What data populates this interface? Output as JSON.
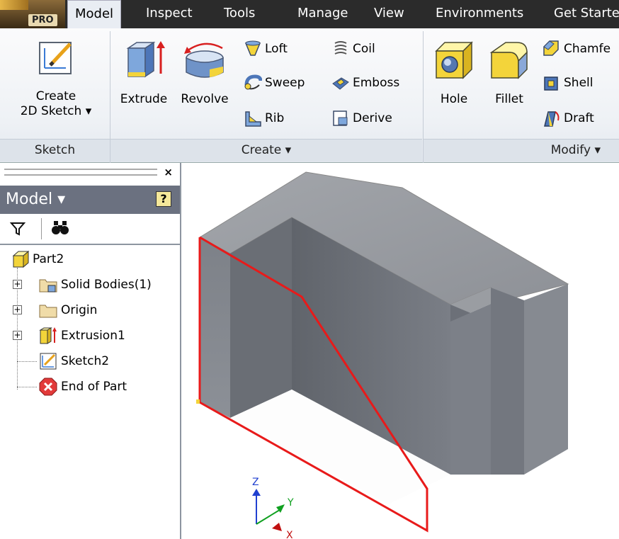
{
  "app": {
    "badge": "PRO"
  },
  "tabs": [
    {
      "label": "Model",
      "active": true
    },
    {
      "label": "Inspect"
    },
    {
      "label": "Tools"
    },
    {
      "label": "Manage"
    },
    {
      "label": "View"
    },
    {
      "label": "Environments"
    },
    {
      "label": "Get Starte"
    }
  ],
  "ribbon": {
    "sketch_panel": {
      "create_line1": "Create",
      "create_line2": "2D Sketch",
      "dropdown": "▾",
      "label": "Sketch"
    },
    "create_panel": {
      "extrude": "Extrude",
      "revolve": "Revolve",
      "loft": "Loft",
      "sweep": "Sweep",
      "rib": "Rib",
      "coil": "Coil",
      "emboss": "Emboss",
      "derive": "Derive",
      "label": "Create",
      "label_arrow": "▾"
    },
    "modify_panel": {
      "hole": "Hole",
      "fillet": "Fillet",
      "chamfer": "Chamfe",
      "shell": "Shell",
      "draft": "Draft",
      "label": "Modify",
      "label_arrow": "▾"
    }
  },
  "browser": {
    "close": "×",
    "title": "Model",
    "title_arrow": "▾",
    "help": "?",
    "tree": [
      {
        "label": "Part2"
      },
      {
        "label": "Solid Bodies(1)"
      },
      {
        "label": "Origin"
      },
      {
        "label": "Extrusion1"
      },
      {
        "label": "Sketch2"
      },
      {
        "label": "End of Part"
      }
    ]
  },
  "viewport": {
    "axes": {
      "z": "Z",
      "y": "Y",
      "x": "X"
    },
    "colors": {
      "sketch_profile": "#e81a1a",
      "body_top": "#9b9ea3",
      "body_front": "#6e727a"
    }
  }
}
